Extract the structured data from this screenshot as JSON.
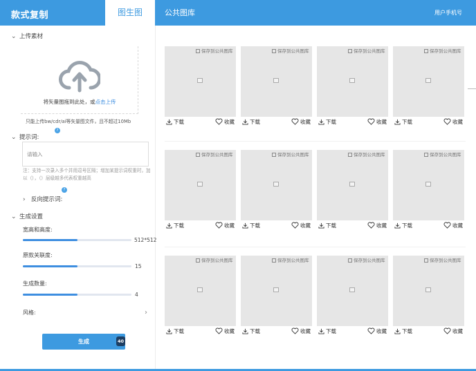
{
  "header": {
    "brand": "款式复制",
    "tabs": [
      "图生图",
      "公共图库"
    ],
    "user": "用户手机号"
  },
  "sidebar": {
    "upload": {
      "section_title": "上传素材",
      "drop_text": "将矢量图拖到此处，或",
      "upload_link": "点击上传",
      "note": "只能上传bw/cdr/ai等矢量图文件，且不超过10Mb"
    },
    "prompt": {
      "label": "提示词:",
      "badge": "?",
      "placeholder": "请输入",
      "value": "",
      "note": "注：支持一次录入多个并用逗号区隔；增加某提示词权重时，加以（），（）层级越多代表权重越高"
    },
    "negative_prompt": {
      "label": "反向提示词:",
      "badge": "?"
    },
    "settings": {
      "section_title": "生成设置",
      "size": {
        "label": "宽高和高度:",
        "value": "512*512",
        "fill": 0.5
      },
      "relevance": {
        "label": "原款关联度:",
        "value": "15",
        "fill": 0.5
      },
      "count": {
        "label": "生成数量:",
        "value": "4",
        "fill": 0.5
      },
      "style": {
        "label": "风格:"
      }
    },
    "generate": {
      "label": "生成",
      "count": "40"
    }
  },
  "grid": {
    "save_label": "保存到公共图库",
    "download_label": "下载",
    "favorite_label": "收藏",
    "rows": 3,
    "cols": 4
  },
  "colors": {
    "accent": "#3d9ae0",
    "thumb_bg": "#e6e6e6",
    "count_badge": "#1d3e63"
  },
  "icons": {
    "collapse": "chevron-down-icon",
    "expand": "chevron-right-icon",
    "upload": "cloud-upload-icon",
    "save": "save-icon",
    "image": "image-placeholder-icon",
    "download": "download-icon",
    "favorite": "heart-icon"
  }
}
